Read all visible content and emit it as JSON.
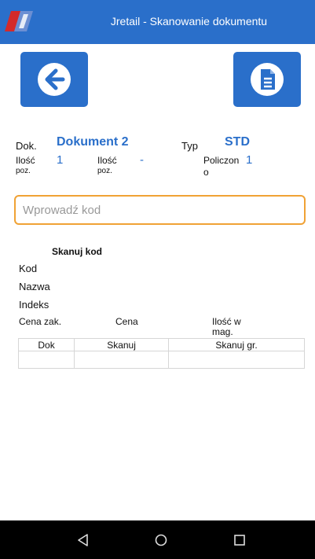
{
  "appbar": {
    "title": "Jretail - Skanowanie dokumentu"
  },
  "info": {
    "dok_label": "Dok.",
    "dok_value": "Dokument 2",
    "typ_label": "Typ",
    "typ_value": "STD",
    "ilosc_poz_label_1": "Ilość",
    "ilosc_poz_label_2": "poz.",
    "ilosc_poz_value": "1",
    "ilosc_poz2_label_1": "Ilość",
    "ilosc_poz2_label_2": "poz.",
    "ilosc_poz2_value": "-",
    "policzono_label_1": "Policzon",
    "policzono_label_2": "o",
    "policzono_value": "1"
  },
  "search": {
    "placeholder": "Wprowadź kod",
    "value": ""
  },
  "scan": {
    "heading": "Skanuj kod",
    "kod_label": "Kod",
    "nazwa_label": "Nazwa",
    "indeks_label": "Indeks",
    "cena_zak_label": "Cena zak.",
    "cena_label": "Cena",
    "ilosc_mag_label_1": "Ilość w",
    "ilosc_mag_label_2": "mag."
  },
  "table": {
    "headers": [
      "Dok",
      "Skanuj",
      "Skanuj gr."
    ],
    "rows": [
      [
        "",
        "",
        ""
      ]
    ]
  },
  "colors": {
    "primary": "#2a6fca",
    "input_border": "#f0a235",
    "navbar": "#000000"
  },
  "icons": {
    "back": "arrow-left-circle-icon",
    "document": "document-icon",
    "nav_back": "triangle-back-icon",
    "nav_home": "circle-home-icon",
    "nav_recent": "square-recent-icon"
  }
}
